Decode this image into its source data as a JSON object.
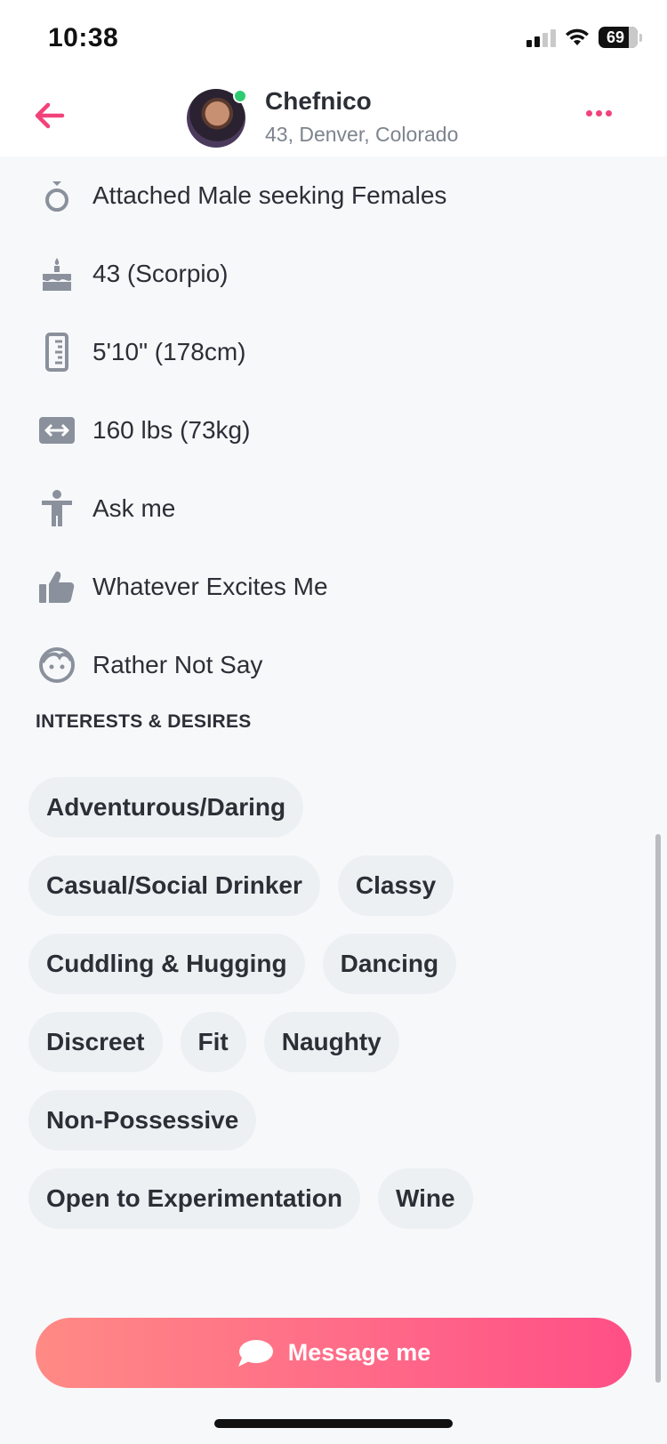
{
  "status_bar": {
    "time": "10:38",
    "battery": "69"
  },
  "header": {
    "username": "Chefnico",
    "location": "43, Denver, Colorado"
  },
  "details": [
    {
      "icon": "ring-icon",
      "text": "Attached Male seeking Females"
    },
    {
      "icon": "cake-icon",
      "text": "43 (Scorpio)"
    },
    {
      "icon": "ruler-icon",
      "text": "5'10\" (178cm)"
    },
    {
      "icon": "weight-icon",
      "text": "160 lbs (73kg)"
    },
    {
      "icon": "body-icon",
      "text": "Ask me"
    },
    {
      "icon": "thumbs-up-icon",
      "text": "Whatever Excites Me"
    },
    {
      "icon": "face-icon",
      "text": "Rather Not Say"
    }
  ],
  "interests": {
    "title": "INTERESTS & DESIRES",
    "rows": [
      [
        "Adventurous/Daring"
      ],
      [
        "Casual/Social Drinker",
        "Classy"
      ],
      [
        "Cuddling & Hugging",
        "Dancing"
      ],
      [
        "Discreet",
        "Fit",
        "Naughty"
      ],
      [
        "Non-Possessive"
      ],
      [
        "Open to Experimentation",
        "Wine"
      ]
    ]
  },
  "message_button": {
    "label": "Message me"
  },
  "colors": {
    "accent": "#f2427a",
    "gradient_start": "#ff8a85",
    "gradient_end": "#ff4f86",
    "icon_gray": "#8a919c",
    "chip_bg": "#edf0f3"
  }
}
